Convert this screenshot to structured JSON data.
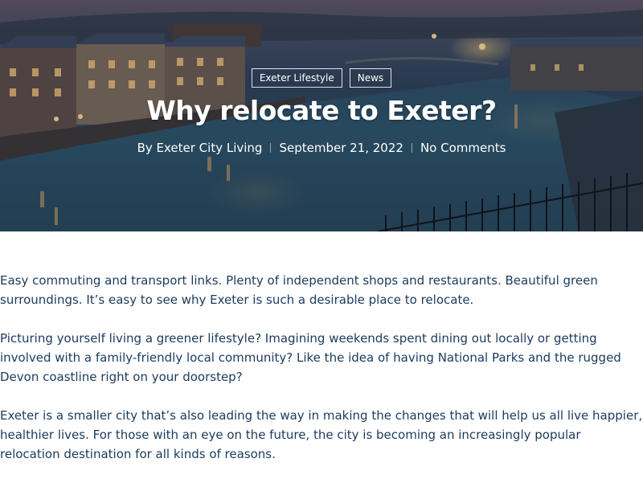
{
  "hero": {
    "tags": [
      "Exeter Lifestyle",
      "News"
    ],
    "title": "Why relocate to Exeter?",
    "author": "By Exeter City Living",
    "date": "September 21, 2022",
    "comments": "No Comments"
  },
  "article": {
    "paragraphs": [
      "Easy commuting and transport links. Plenty of independent shops and restaurants. Beautiful green surroundings. It’s easy to see why Exeter is such a desirable place to relocate.",
      "Picturing yourself living a greener lifestyle? Imagining weekends spent dining out locally or getting involved with a family-friendly local community? Like the idea of having National Parks and the rugged Devon coastline right on your doorstep?",
      "Exeter is a smaller city that’s also leading the way in making the changes that will help us all live happier, healthier lives. For those with an eye on the future, the city is becoming an increasingly popular relocation destination for all kinds of reasons."
    ]
  },
  "colors": {
    "text": "#1b3a5c",
    "hero_text": "#ffffff"
  }
}
